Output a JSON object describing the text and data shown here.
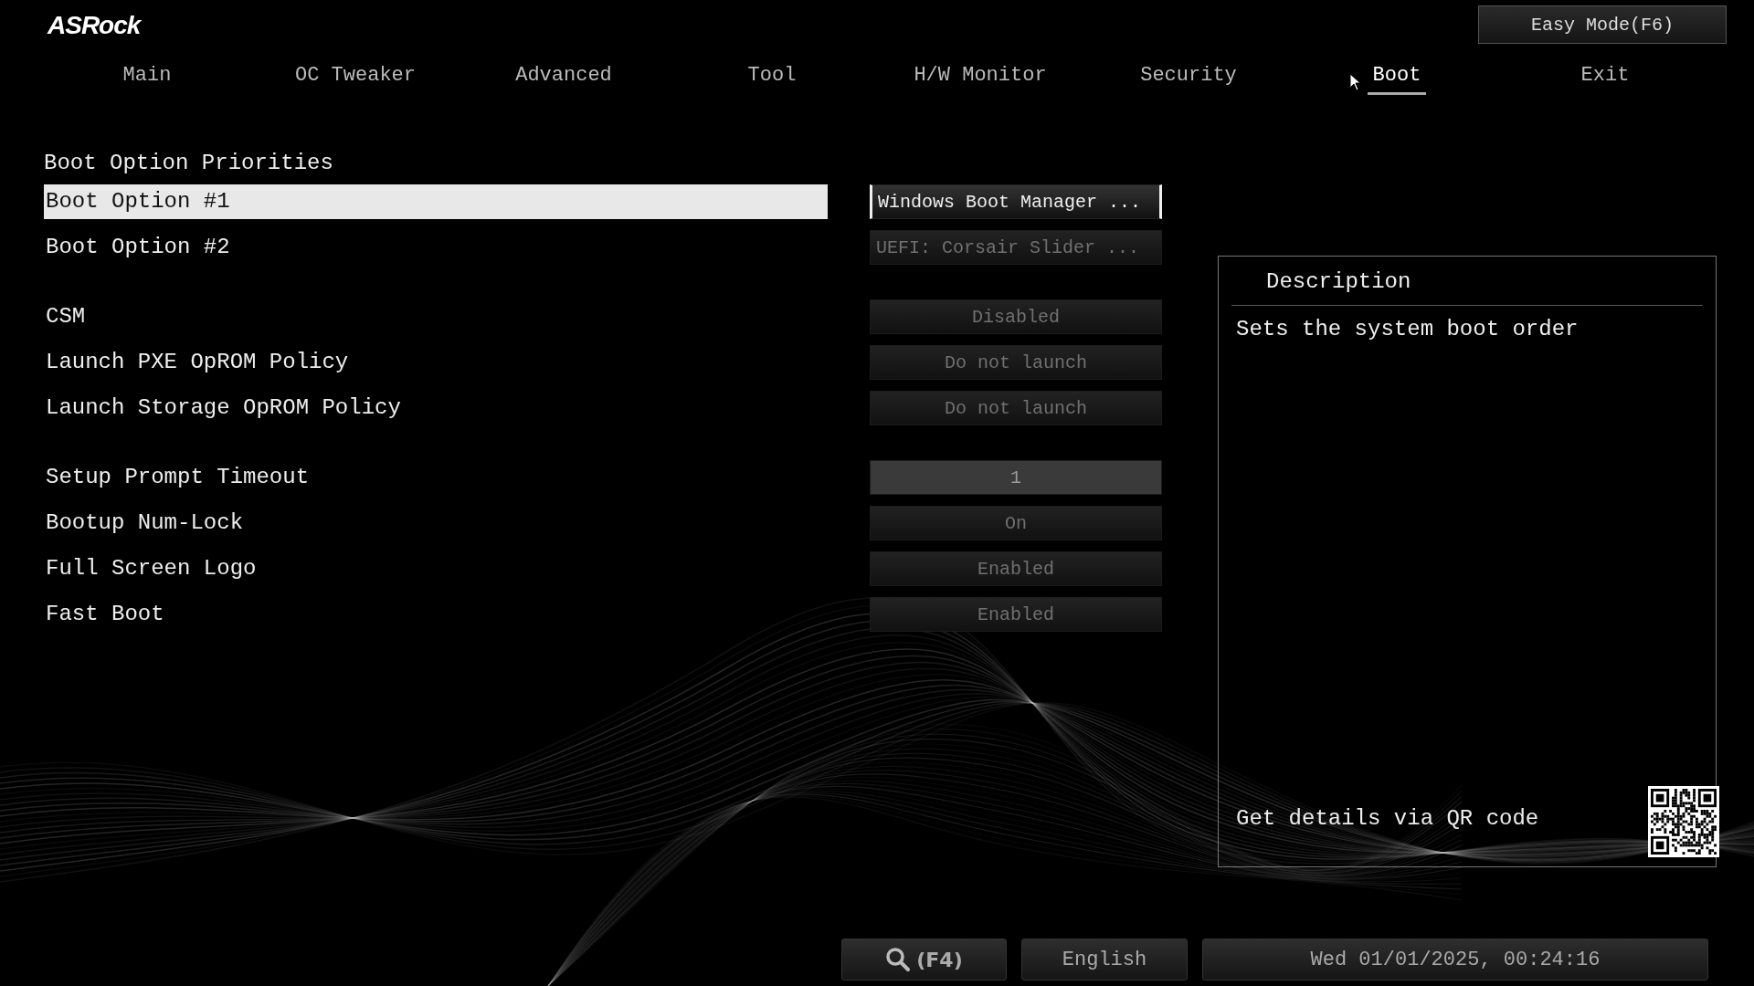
{
  "brand": "ASRock",
  "mode_button": "Easy Mode(F6)",
  "tabs": [
    {
      "label": "Main",
      "selected": false
    },
    {
      "label": "OC Tweaker",
      "selected": false
    },
    {
      "label": "Advanced",
      "selected": false
    },
    {
      "label": "Tool",
      "selected": false
    },
    {
      "label": "H/W Monitor",
      "selected": false
    },
    {
      "label": "Security",
      "selected": false
    },
    {
      "label": "Boot",
      "selected": true
    },
    {
      "label": "Exit",
      "selected": false
    }
  ],
  "groups": [
    {
      "heading": "Boot Option Priorities",
      "items": [
        {
          "label": "Boot Option #1",
          "value": "Windows Boot Manager ...",
          "kind": "text",
          "selected": true
        },
        {
          "label": "Boot Option #2",
          "value": "UEFI: Corsair Slider ...",
          "kind": "text",
          "selected": false
        }
      ]
    },
    {
      "items": [
        {
          "label": "CSM",
          "value": "Disabled",
          "kind": "choice",
          "selected": false
        },
        {
          "label": "Launch PXE OpROM Policy",
          "value": "Do not launch",
          "kind": "choice",
          "selected": false
        },
        {
          "label": "Launch Storage OpROM Policy",
          "value": "Do not launch",
          "kind": "choice",
          "selected": false
        }
      ]
    },
    {
      "items": [
        {
          "label": "Setup Prompt Timeout",
          "value": "1",
          "kind": "number",
          "selected": false
        },
        {
          "label": "Bootup Num-Lock",
          "value": "On",
          "kind": "choice",
          "selected": false
        },
        {
          "label": "Full Screen Logo",
          "value": "Enabled",
          "kind": "choice",
          "selected": false
        },
        {
          "label": "Fast Boot",
          "value": "Enabled",
          "kind": "choice",
          "selected": false
        }
      ]
    }
  ],
  "description": {
    "title": "Description",
    "text": "Sets the system boot order",
    "qr_text": "Get details via QR code"
  },
  "status_bar": {
    "search": "(F4)",
    "language": "English",
    "datetime": "Wed 01/01/2025, 00:24:16"
  }
}
